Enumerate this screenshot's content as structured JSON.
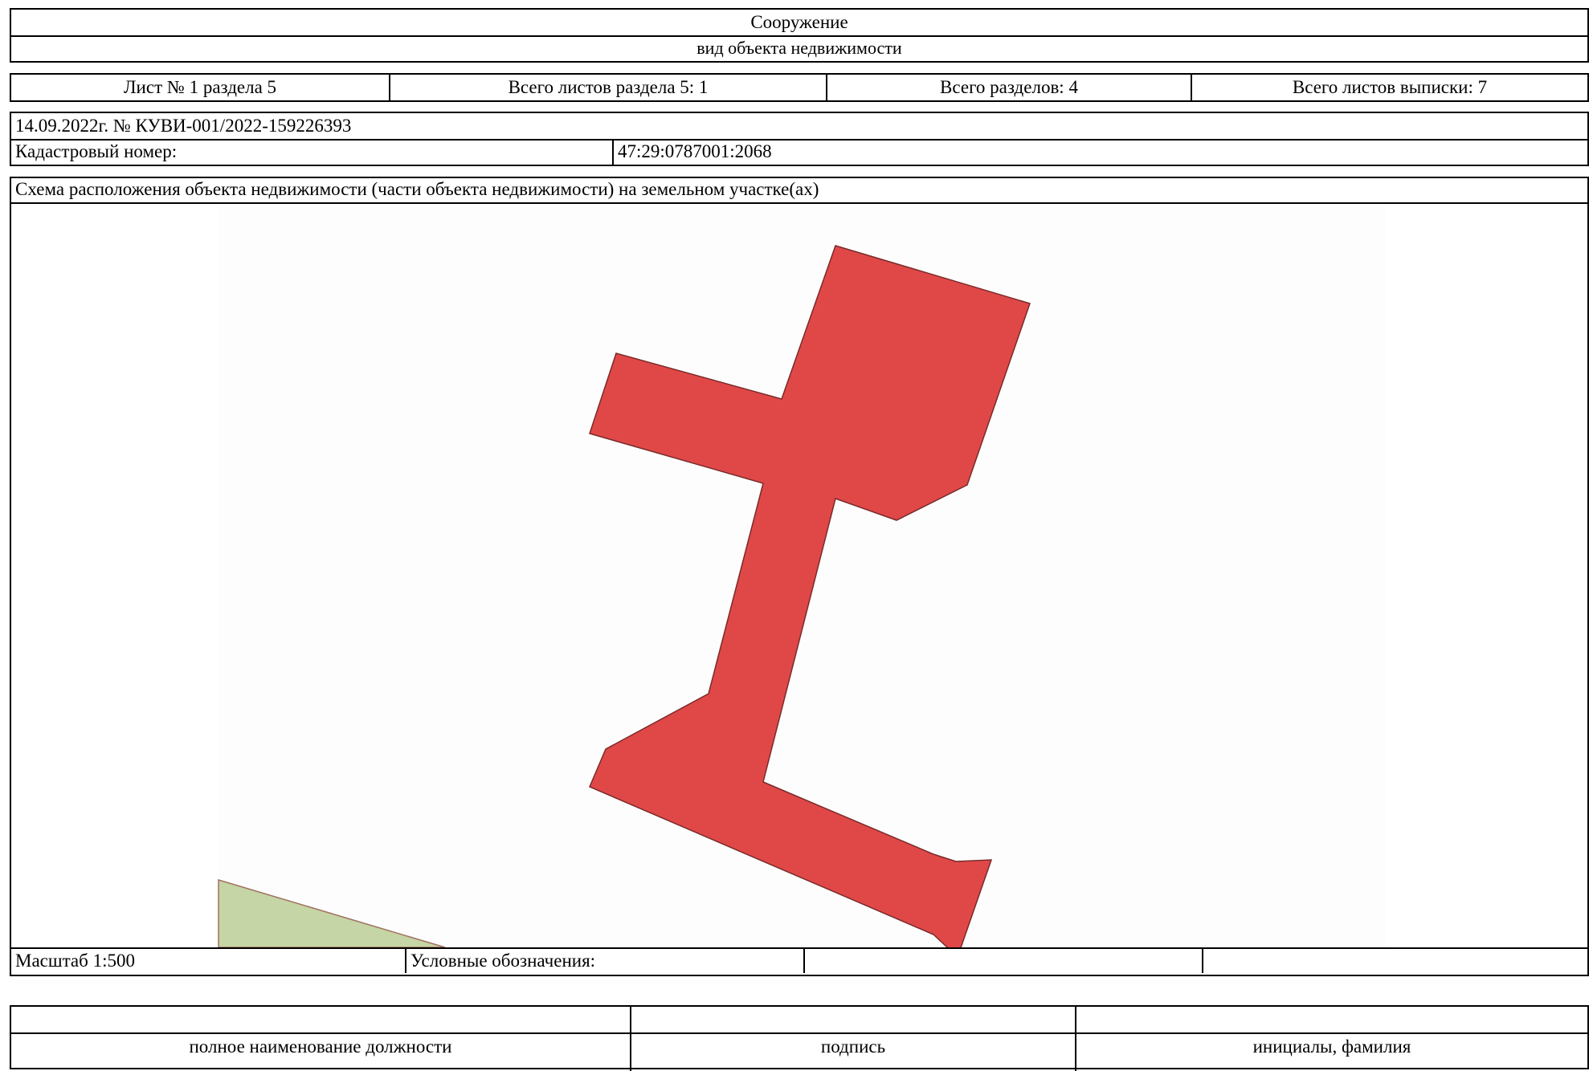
{
  "header": {
    "object_kind": "Сооружение",
    "object_kind_caption": "вид объекта недвижимости"
  },
  "sheet_info": {
    "sheet": "Лист № 1 раздела 5",
    "section_sheets": "Всего листов раздела 5: 1",
    "total_sections": "Всего разделов: 4",
    "total_sheets": "Всего листов выписки: 7"
  },
  "record": {
    "date_number": "14.09.2022г. № КУВИ-001/2022-159226393",
    "cadastral_label": "Кадастровый номер:",
    "cadastral_value": "47:29:0787001:2068"
  },
  "scheme": {
    "title": "Схема расположения объекта недвижимости (части объекта недвижимости) на земельном участке(ах)",
    "object_fill": "#e04848",
    "object_stroke": "#7a2a2a",
    "parcel_fill": "#c5d5a5",
    "parcel_stroke": "#a07060"
  },
  "legend_row": {
    "scale": "Масштаб 1:500",
    "legend_label": "Условные обозначения:",
    "legend_cell_2": "",
    "legend_cell_3": ""
  },
  "signature": {
    "position_value": "",
    "signature_value": "",
    "name_value": "",
    "position_caption": "полное наименование должности",
    "signature_caption": "подпись",
    "name_caption": "инициалы, фамилия"
  }
}
